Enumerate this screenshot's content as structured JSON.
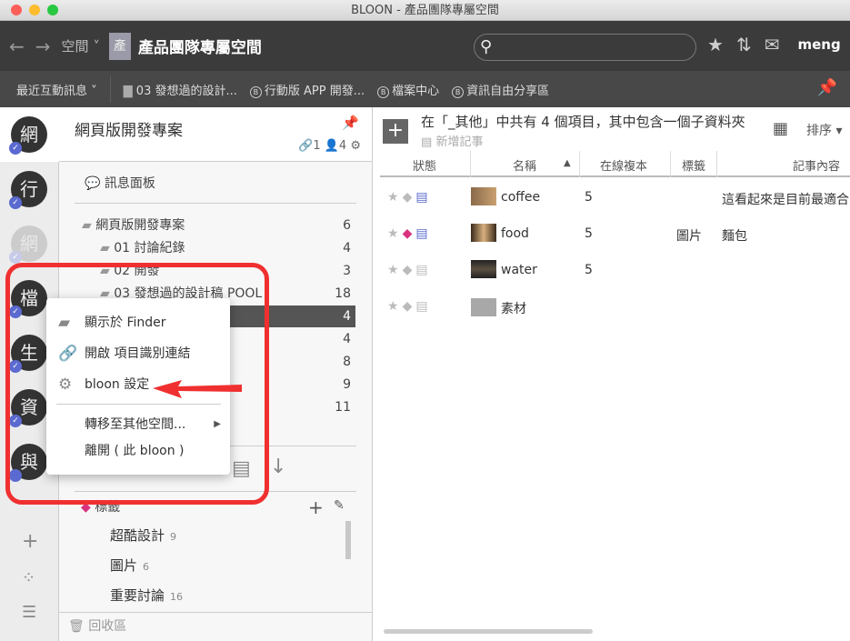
{
  "window": {
    "title": "BLOON - 產品團隊專屬空間"
  },
  "toolbar": {
    "space_label": "空間",
    "space_badge": "產",
    "space_title": "產品團隊專屬空間",
    "user": "meng"
  },
  "bookmarks": {
    "recent": "最近互動訊息",
    "items": [
      "03 發想過的設計...",
      "行動版 APP 開發...",
      "檔案中心",
      "資訊自由分享區"
    ]
  },
  "rail": {
    "avatars": [
      "網",
      "行",
      "網",
      "檔",
      "生",
      "資",
      "與"
    ]
  },
  "tree": {
    "title": "網頁版開發專案",
    "links": "1",
    "members": "4",
    "message_board": "訊息面板",
    "rows": [
      {
        "label": "網頁版開發專案",
        "count": "6"
      },
      {
        "label": "01 討論紀錄",
        "count": "4"
      },
      {
        "label": "02 開發",
        "count": "3"
      },
      {
        "label": "03 發想過的設計稿 POOL",
        "count": "18"
      },
      {
        "label": "",
        "count": "4"
      },
      {
        "label": "",
        "count": "4"
      },
      {
        "label": "",
        "count": "8"
      },
      {
        "label": "",
        "count": "9"
      },
      {
        "label": "",
        "count": "11"
      }
    ],
    "tags_label": "標籤",
    "tags": [
      {
        "name": "超酷設計",
        "count": "9"
      },
      {
        "name": "圖片",
        "count": "6"
      },
      {
        "name": "重要討論",
        "count": "16"
      }
    ],
    "trash": "回收區"
  },
  "context_menu": {
    "items": [
      "顯示於 Finder",
      "開啟 項目識別連結",
      "bloon 設定",
      "轉移至其他空間...",
      "離開 ( 此 bloon )"
    ]
  },
  "main": {
    "title": "在「_其他」中共有 4 個項目，其中包含一個子資料夾",
    "new_note": "新增記事",
    "sort": "排序",
    "columns": [
      "狀態",
      "名稱",
      "在線複本",
      "標籤",
      "記事內容"
    ],
    "rows": [
      {
        "name": "coffee",
        "copies": "5",
        "tag": "",
        "note": "這看起來是目前最適合",
        "tagged": false,
        "has_note": true
      },
      {
        "name": "food",
        "copies": "5",
        "tag": "圖片",
        "note": "麵包",
        "tagged": true,
        "has_note": true
      },
      {
        "name": "water",
        "copies": "5",
        "tag": "",
        "note": "",
        "tagged": false,
        "has_note": false
      },
      {
        "name": "素材",
        "copies": "",
        "tag": "",
        "note": "",
        "tagged": false,
        "has_note": false
      }
    ]
  },
  "colors": {
    "accent_blue": "#5a6ad0",
    "tag_pink": "#d9337f",
    "annotation_red": "#f03030",
    "link_green": "#3ab03a"
  }
}
